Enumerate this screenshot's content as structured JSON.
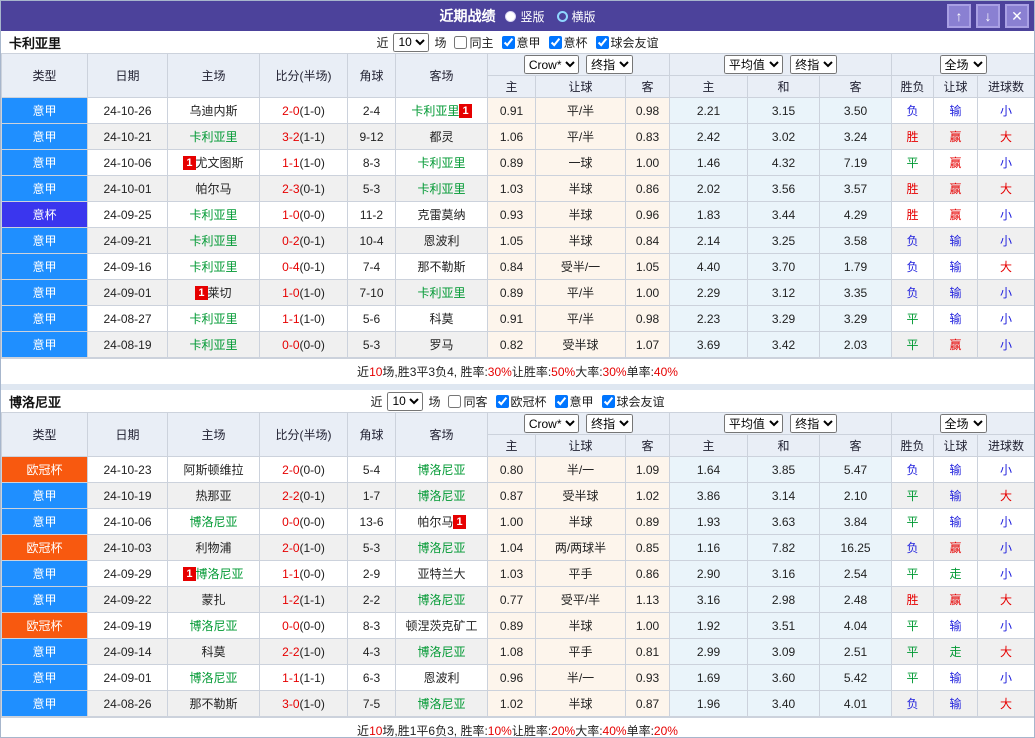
{
  "header": {
    "title": "近期战绩",
    "radio_vertical": "竖版",
    "radio_horizontal": "横版",
    "selected_layout": "竖版"
  },
  "icons": {
    "up": "↑",
    "down": "↓",
    "close": "✕"
  },
  "card_label": "1",
  "colors": {
    "titlebar": "#4c429b",
    "accent_red": "#e60000",
    "green": "#009933",
    "blue": "#2222dd",
    "row_alt": "#f0f0f0",
    "handicap_bg": "#fdf5ec",
    "average_bg": "#eaf4fa",
    "header_bg": "#e9eef6"
  },
  "type_colors": {
    "意甲": "#1f8fff",
    "意杯": "#3a36ee",
    "欧冠杯": "#f8590f"
  },
  "result_colors": {
    "胜": "red",
    "平": "green",
    "负": "blue",
    "赢": "red",
    "走": "green",
    "输": "blue",
    "大": "red",
    "小": "blue"
  },
  "columns": {
    "type": "类型",
    "date": "日期",
    "home": "主场",
    "score": "比分(半场)",
    "corner": "角球",
    "away": "客场",
    "h": "主",
    "handicap": "让球",
    "a": "客",
    "avg_h": "主",
    "draw": "和",
    "avg_a": "客",
    "wdl": "胜负",
    "handicap2": "让球",
    "goals": "进球数"
  },
  "sections": [
    {
      "team": "卡利亚里",
      "filter": {
        "near": "近",
        "count": "10",
        "unit": "场",
        "same": "同主",
        "same_checked": false,
        "leagues": [
          "意甲",
          "意杯",
          "球会友谊"
        ],
        "league_checked": [
          true,
          true,
          true
        ]
      },
      "selects": {
        "odds_source": "Crow*",
        "odds_time": "终指",
        "avg_source": "平均值",
        "avg_time": "终指",
        "scope": "全场"
      },
      "rows": [
        {
          "type": "意甲",
          "date": "24-10-26",
          "home": "乌迪内斯",
          "hg": false,
          "hc": "",
          "score": "2-0",
          "half": "(1-0)",
          "corner": "2-4",
          "away": "卡利亚里",
          "ag": true,
          "ac": "after",
          "o": [
            "0.91",
            "平/半",
            "0.98"
          ],
          "avg": [
            "2.21",
            "3.15",
            "3.50"
          ],
          "res": [
            "负",
            "输",
            "小"
          ]
        },
        {
          "type": "意甲",
          "date": "24-10-21",
          "home": "卡利亚里",
          "hg": true,
          "hc": "",
          "score": "3-2",
          "half": "(1-1)",
          "corner": "9-12",
          "away": "都灵",
          "ag": false,
          "ac": "",
          "o": [
            "1.06",
            "平/半",
            "0.83"
          ],
          "avg": [
            "2.42",
            "3.02",
            "3.24"
          ],
          "res": [
            "胜",
            "赢",
            "大"
          ]
        },
        {
          "type": "意甲",
          "date": "24-10-06",
          "home": "尤文图斯",
          "hg": false,
          "hc": "before",
          "score": "1-1",
          "half": "(1-0)",
          "corner": "8-3",
          "away": "卡利亚里",
          "ag": true,
          "ac": "",
          "o": [
            "0.89",
            "一球",
            "1.00"
          ],
          "avg": [
            "1.46",
            "4.32",
            "7.19"
          ],
          "res": [
            "平",
            "赢",
            "小"
          ]
        },
        {
          "type": "意甲",
          "date": "24-10-01",
          "home": "帕尔马",
          "hg": false,
          "hc": "",
          "score": "2-3",
          "half": "(0-1)",
          "corner": "5-3",
          "away": "卡利亚里",
          "ag": true,
          "ac": "",
          "o": [
            "1.03",
            "半球",
            "0.86"
          ],
          "avg": [
            "2.02",
            "3.56",
            "3.57"
          ],
          "res": [
            "胜",
            "赢",
            "大"
          ]
        },
        {
          "type": "意杯",
          "date": "24-09-25",
          "home": "卡利亚里",
          "hg": true,
          "hc": "",
          "score": "1-0",
          "half": "(0-0)",
          "corner": "11-2",
          "away": "克雷莫纳",
          "ag": false,
          "ac": "",
          "o": [
            "0.93",
            "半球",
            "0.96"
          ],
          "avg": [
            "1.83",
            "3.44",
            "4.29"
          ],
          "res": [
            "胜",
            "赢",
            "小"
          ]
        },
        {
          "type": "意甲",
          "date": "24-09-21",
          "home": "卡利亚里",
          "hg": true,
          "hc": "",
          "score": "0-2",
          "half": "(0-1)",
          "corner": "10-4",
          "away": "恩波利",
          "ag": false,
          "ac": "",
          "o": [
            "1.05",
            "半球",
            "0.84"
          ],
          "avg": [
            "2.14",
            "3.25",
            "3.58"
          ],
          "res": [
            "负",
            "输",
            "小"
          ]
        },
        {
          "type": "意甲",
          "date": "24-09-16",
          "home": "卡利亚里",
          "hg": true,
          "hc": "",
          "score": "0-4",
          "half": "(0-1)",
          "corner": "7-4",
          "away": "那不勒斯",
          "ag": false,
          "ac": "",
          "o": [
            "0.84",
            "受半/一",
            "1.05"
          ],
          "avg": [
            "4.40",
            "3.70",
            "1.79"
          ],
          "res": [
            "负",
            "输",
            "大"
          ]
        },
        {
          "type": "意甲",
          "date": "24-09-01",
          "home": "莱切",
          "hg": false,
          "hc": "before",
          "score": "1-0",
          "half": "(1-0)",
          "corner": "7-10",
          "away": "卡利亚里",
          "ag": true,
          "ac": "",
          "o": [
            "0.89",
            "平/半",
            "1.00"
          ],
          "avg": [
            "2.29",
            "3.12",
            "3.35"
          ],
          "res": [
            "负",
            "输",
            "小"
          ]
        },
        {
          "type": "意甲",
          "date": "24-08-27",
          "home": "卡利亚里",
          "hg": true,
          "hc": "",
          "score": "1-1",
          "half": "(1-0)",
          "corner": "5-6",
          "away": "科莫",
          "ag": false,
          "ac": "",
          "o": [
            "0.91",
            "平/半",
            "0.98"
          ],
          "avg": [
            "2.23",
            "3.29",
            "3.29"
          ],
          "res": [
            "平",
            "输",
            "小"
          ]
        },
        {
          "type": "意甲",
          "date": "24-08-19",
          "home": "卡利亚里",
          "hg": true,
          "hc": "",
          "score": "0-0",
          "half": "(0-0)",
          "corner": "5-3",
          "away": "罗马",
          "ag": false,
          "ac": "",
          "o": [
            "0.82",
            "受半球",
            "1.07"
          ],
          "avg": [
            "3.69",
            "3.42",
            "2.03"
          ],
          "res": [
            "平",
            "赢",
            "小"
          ]
        }
      ],
      "summary": [
        {
          "t": "近"
        },
        {
          "t": "10",
          "red": true
        },
        {
          "t": "场,胜3平3负4, 胜率:"
        },
        {
          "t": "30%",
          "red": true
        },
        {
          "t": " 让胜率:"
        },
        {
          "t": "50%",
          "red": true
        },
        {
          "t": " 大率:"
        },
        {
          "t": "30%",
          "red": true
        },
        {
          "t": " 单率:"
        },
        {
          "t": "40%",
          "red": true
        }
      ]
    },
    {
      "team": "博洛尼亚",
      "filter": {
        "near": "近",
        "count": "10",
        "unit": "场",
        "same": "同客",
        "same_checked": false,
        "leagues": [
          "欧冠杯",
          "意甲",
          "球会友谊"
        ],
        "league_checked": [
          true,
          true,
          true
        ]
      },
      "selects": {
        "odds_source": "Crow*",
        "odds_time": "终指",
        "avg_source": "平均值",
        "avg_time": "终指",
        "scope": "全场"
      },
      "rows": [
        {
          "type": "欧冠杯",
          "date": "24-10-23",
          "home": "阿斯顿维拉",
          "hg": false,
          "hc": "",
          "score": "2-0",
          "half": "(0-0)",
          "corner": "5-4",
          "away": "博洛尼亚",
          "ag": true,
          "ac": "",
          "o": [
            "0.80",
            "半/一",
            "1.09"
          ],
          "avg": [
            "1.64",
            "3.85",
            "5.47"
          ],
          "res": [
            "负",
            "输",
            "小"
          ]
        },
        {
          "type": "意甲",
          "date": "24-10-19",
          "home": "热那亚",
          "hg": false,
          "hc": "",
          "score": "2-2",
          "half": "(0-1)",
          "corner": "1-7",
          "away": "博洛尼亚",
          "ag": true,
          "ac": "",
          "o": [
            "0.87",
            "受半球",
            "1.02"
          ],
          "avg": [
            "3.86",
            "3.14",
            "2.10"
          ],
          "res": [
            "平",
            "输",
            "大"
          ]
        },
        {
          "type": "意甲",
          "date": "24-10-06",
          "home": "博洛尼亚",
          "hg": true,
          "hc": "",
          "score": "0-0",
          "half": "(0-0)",
          "corner": "13-6",
          "away": "帕尔马",
          "ag": false,
          "ac": "after",
          "o": [
            "1.00",
            "半球",
            "0.89"
          ],
          "avg": [
            "1.93",
            "3.63",
            "3.84"
          ],
          "res": [
            "平",
            "输",
            "小"
          ]
        },
        {
          "type": "欧冠杯",
          "date": "24-10-03",
          "home": "利物浦",
          "hg": false,
          "hc": "",
          "score": "2-0",
          "half": "(1-0)",
          "corner": "5-3",
          "away": "博洛尼亚",
          "ag": true,
          "ac": "",
          "o": [
            "1.04",
            "两/两球半",
            "0.85"
          ],
          "avg": [
            "1.16",
            "7.82",
            "16.25"
          ],
          "res": [
            "负",
            "赢",
            "小"
          ]
        },
        {
          "type": "意甲",
          "date": "24-09-29",
          "home": "博洛尼亚",
          "hg": true,
          "hc": "before",
          "score": "1-1",
          "half": "(0-0)",
          "corner": "2-9",
          "away": "亚特兰大",
          "ag": false,
          "ac": "",
          "o": [
            "1.03",
            "平手",
            "0.86"
          ],
          "avg": [
            "2.90",
            "3.16",
            "2.54"
          ],
          "res": [
            "平",
            "走",
            "小"
          ]
        },
        {
          "type": "意甲",
          "date": "24-09-22",
          "home": "蒙扎",
          "hg": false,
          "hc": "",
          "score": "1-2",
          "half": "(1-1)",
          "corner": "2-2",
          "away": "博洛尼亚",
          "ag": true,
          "ac": "",
          "o": [
            "0.77",
            "受平/半",
            "1.13"
          ],
          "avg": [
            "3.16",
            "2.98",
            "2.48"
          ],
          "res": [
            "胜",
            "赢",
            "大"
          ]
        },
        {
          "type": "欧冠杯",
          "date": "24-09-19",
          "home": "博洛尼亚",
          "hg": true,
          "hc": "",
          "score": "0-0",
          "half": "(0-0)",
          "corner": "8-3",
          "away": "顿涅茨克矿工",
          "ag": false,
          "ac": "",
          "o": [
            "0.89",
            "半球",
            "1.00"
          ],
          "avg": [
            "1.92",
            "3.51",
            "4.04"
          ],
          "res": [
            "平",
            "输",
            "小"
          ]
        },
        {
          "type": "意甲",
          "date": "24-09-14",
          "home": "科莫",
          "hg": false,
          "hc": "",
          "score": "2-2",
          "half": "(1-0)",
          "corner": "4-3",
          "away": "博洛尼亚",
          "ag": true,
          "ac": "",
          "o": [
            "1.08",
            "平手",
            "0.81"
          ],
          "avg": [
            "2.99",
            "3.09",
            "2.51"
          ],
          "res": [
            "平",
            "走",
            "大"
          ]
        },
        {
          "type": "意甲",
          "date": "24-09-01",
          "home": "博洛尼亚",
          "hg": true,
          "hc": "",
          "score": "1-1",
          "half": "(1-1)",
          "corner": "6-3",
          "away": "恩波利",
          "ag": false,
          "ac": "",
          "o": [
            "0.96",
            "半/一",
            "0.93"
          ],
          "avg": [
            "1.69",
            "3.60",
            "5.42"
          ],
          "res": [
            "平",
            "输",
            "小"
          ]
        },
        {
          "type": "意甲",
          "date": "24-08-26",
          "home": "那不勒斯",
          "hg": false,
          "hc": "",
          "score": "3-0",
          "half": "(1-0)",
          "corner": "7-5",
          "away": "博洛尼亚",
          "ag": true,
          "ac": "",
          "o": [
            "1.02",
            "半球",
            "0.87"
          ],
          "avg": [
            "1.96",
            "3.40",
            "4.01"
          ],
          "res": [
            "负",
            "输",
            "大"
          ]
        }
      ],
      "summary": [
        {
          "t": "近"
        },
        {
          "t": "10",
          "red": true
        },
        {
          "t": "场,胜1平6负3, 胜率:"
        },
        {
          "t": "10%",
          "red": true
        },
        {
          "t": " 让胜率:"
        },
        {
          "t": "20%",
          "red": true
        },
        {
          "t": " 大率:"
        },
        {
          "t": "40%",
          "red": true
        },
        {
          "t": " 单率:"
        },
        {
          "t": "20%",
          "red": true
        }
      ]
    }
  ]
}
